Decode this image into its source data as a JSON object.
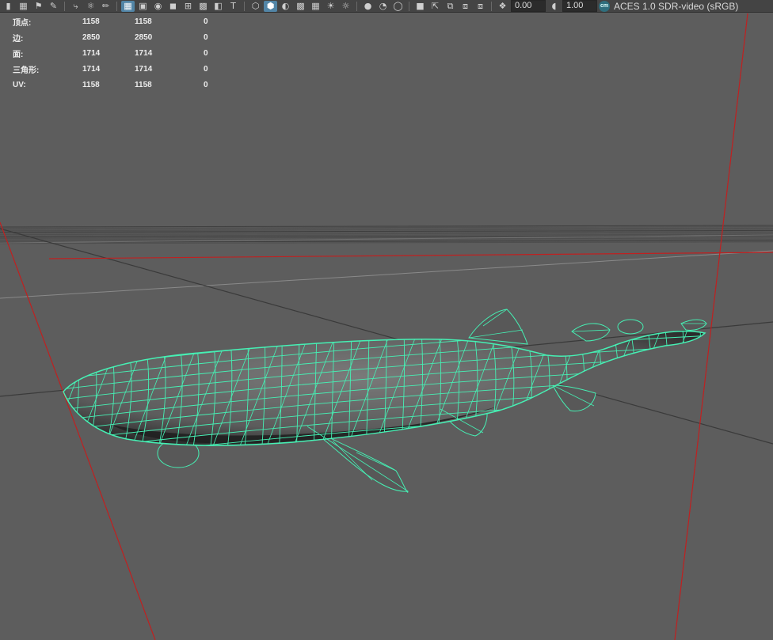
{
  "toolbar": {
    "icons": [
      "camera-icon",
      "camera-attributes-icon",
      "bookmark-icon",
      "image-plane-icon",
      "grid-toggle-icon",
      "film-gate-icon",
      "resolution-gate-icon",
      "safe-action-icon",
      "field-chart-icon",
      "xray-icon",
      "text-icon",
      "wireframe-icon",
      "smooth-shade-icon",
      "default-material-icon",
      "textured-icon",
      "use-all-lights-icon",
      "shadows-icon",
      "ambient-occlusion-icon",
      "motion-blur-icon",
      "anti-aliasing-icon",
      "isolate-select-icon",
      "xray-joints-icon",
      "xray-active-icon",
      "backface-culling-icon",
      "exposure-icon",
      "gamma-icon"
    ],
    "exposure_value": "0.00",
    "gamma_value": "1.00",
    "colorspace_badge": "cm",
    "colorspace_label": "ACES 1.0 SDR-video (sRGB)"
  },
  "hud": {
    "rows": [
      {
        "label": "顶点:",
        "a": "1158",
        "b": "1158",
        "c": "0"
      },
      {
        "label": "边:",
        "a": "2850",
        "b": "2850",
        "c": "0"
      },
      {
        "label": "面:",
        "a": "1714",
        "b": "1714",
        "c": "0"
      },
      {
        "label": "三角形:",
        "a": "1714",
        "b": "1714",
        "c": "0"
      },
      {
        "label": "UV:",
        "a": "1158",
        "b": "1158",
        "c": "0"
      }
    ]
  },
  "colors": {
    "viewport_background": "#5d5d5d",
    "wireframe": "#46f0b4",
    "mesh_shading": "#6a6a6a",
    "axis_red": "#c02020",
    "grid_dark": "#3c3c3c",
    "grid_light": "#7a7a7a"
  }
}
